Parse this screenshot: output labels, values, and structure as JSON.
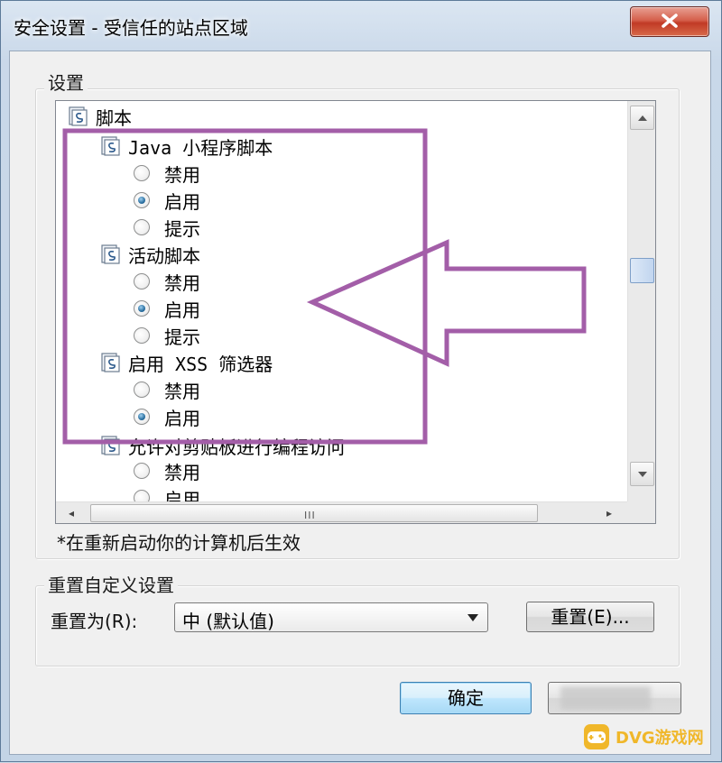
{
  "window": {
    "title": "安全设置 - 受信任的站点区域"
  },
  "settings_group": {
    "legend": "设置",
    "root": {
      "label": "脚本"
    },
    "items": [
      {
        "label": "Java 小程序脚本",
        "options": [
          "禁用",
          "启用",
          "提示"
        ],
        "selected": "启用"
      },
      {
        "label": "活动脚本",
        "options": [
          "禁用",
          "启用",
          "提示"
        ],
        "selected": "启用"
      },
      {
        "label": "启用 XSS 筛选器",
        "options": [
          "禁用",
          "启用"
        ],
        "selected": "启用"
      },
      {
        "label": "允许对剪贴板进行编程访问",
        "options": [
          "禁用",
          "启用"
        ],
        "selected": ""
      }
    ],
    "hscroll_grip": "III",
    "note": "*在重新启动你的计算机后生效"
  },
  "reset_group": {
    "legend": "重置自定义设置",
    "reset_to_label": "重置为(R):",
    "reset_to_value": "中 (默认值)",
    "reset_button": "重置(E)..."
  },
  "footer": {
    "ok_button": "确定"
  },
  "annotation": {
    "color": "#a35ea8"
  },
  "watermark": {
    "text": "DVG游戏网"
  }
}
